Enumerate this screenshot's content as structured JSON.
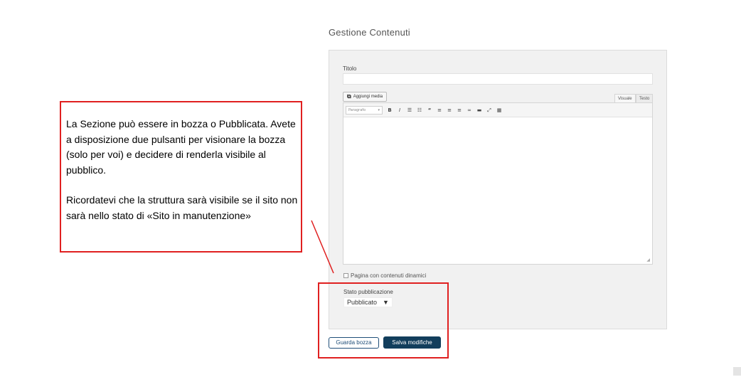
{
  "page": {
    "title": "Gestione Contenuti"
  },
  "form": {
    "title_label": "Titolo",
    "title_value": "",
    "add_media_label": "Aggiungi media",
    "tabs": [
      {
        "label": "Visuale"
      },
      {
        "label": "Testo"
      }
    ],
    "format_select": "Paragrafo",
    "toolbar_icons": [
      "bold-icon",
      "italic-icon",
      "bullet-list-icon",
      "numbered-list-icon",
      "blockquote-icon",
      "align-left-icon",
      "align-center-icon",
      "align-right-icon",
      "link-icon",
      "read-more-icon",
      "fullscreen-icon",
      "toolbar-toggle-icon"
    ],
    "dynamic_content_checkbox": {
      "label": "Pagina con contenuti dinamici",
      "checked": false
    },
    "status_label": "Stato pubblicazione",
    "status_value": "Pubblicato",
    "draft_button": "Guarda bozza",
    "save_button": "Salva modifiche"
  },
  "callout": {
    "paragraph1": "La Sezione può essere in bozza o Pubblicata. Avete a disposizione due pulsanti per visionare la bozza (solo per voi) e decidere di renderla visibile al pubblico.",
    "paragraph2": "Ricordatevi che la struttura sarà visibile se il sito non sarà nello stato di «Sito in manutenzione»"
  },
  "colors": {
    "annotation_red": "#e02020",
    "primary_button": "#123e5c",
    "panel_bg": "#f1f1f1"
  }
}
